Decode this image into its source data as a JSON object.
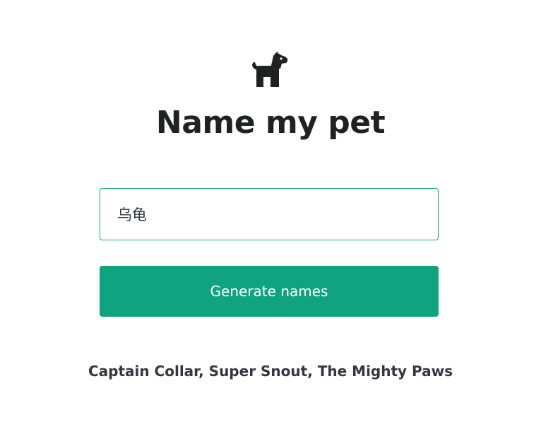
{
  "header": {
    "icon": "dog-icon",
    "title": "Name my pet"
  },
  "form": {
    "animal_input_value": "乌龟",
    "submit_label": "Generate names"
  },
  "result": {
    "text": "Captain Collar, Super Snout, The Mighty Paws"
  },
  "colors": {
    "accent": "#10a37f",
    "title_text": "#202123",
    "body_text": "#353740"
  }
}
